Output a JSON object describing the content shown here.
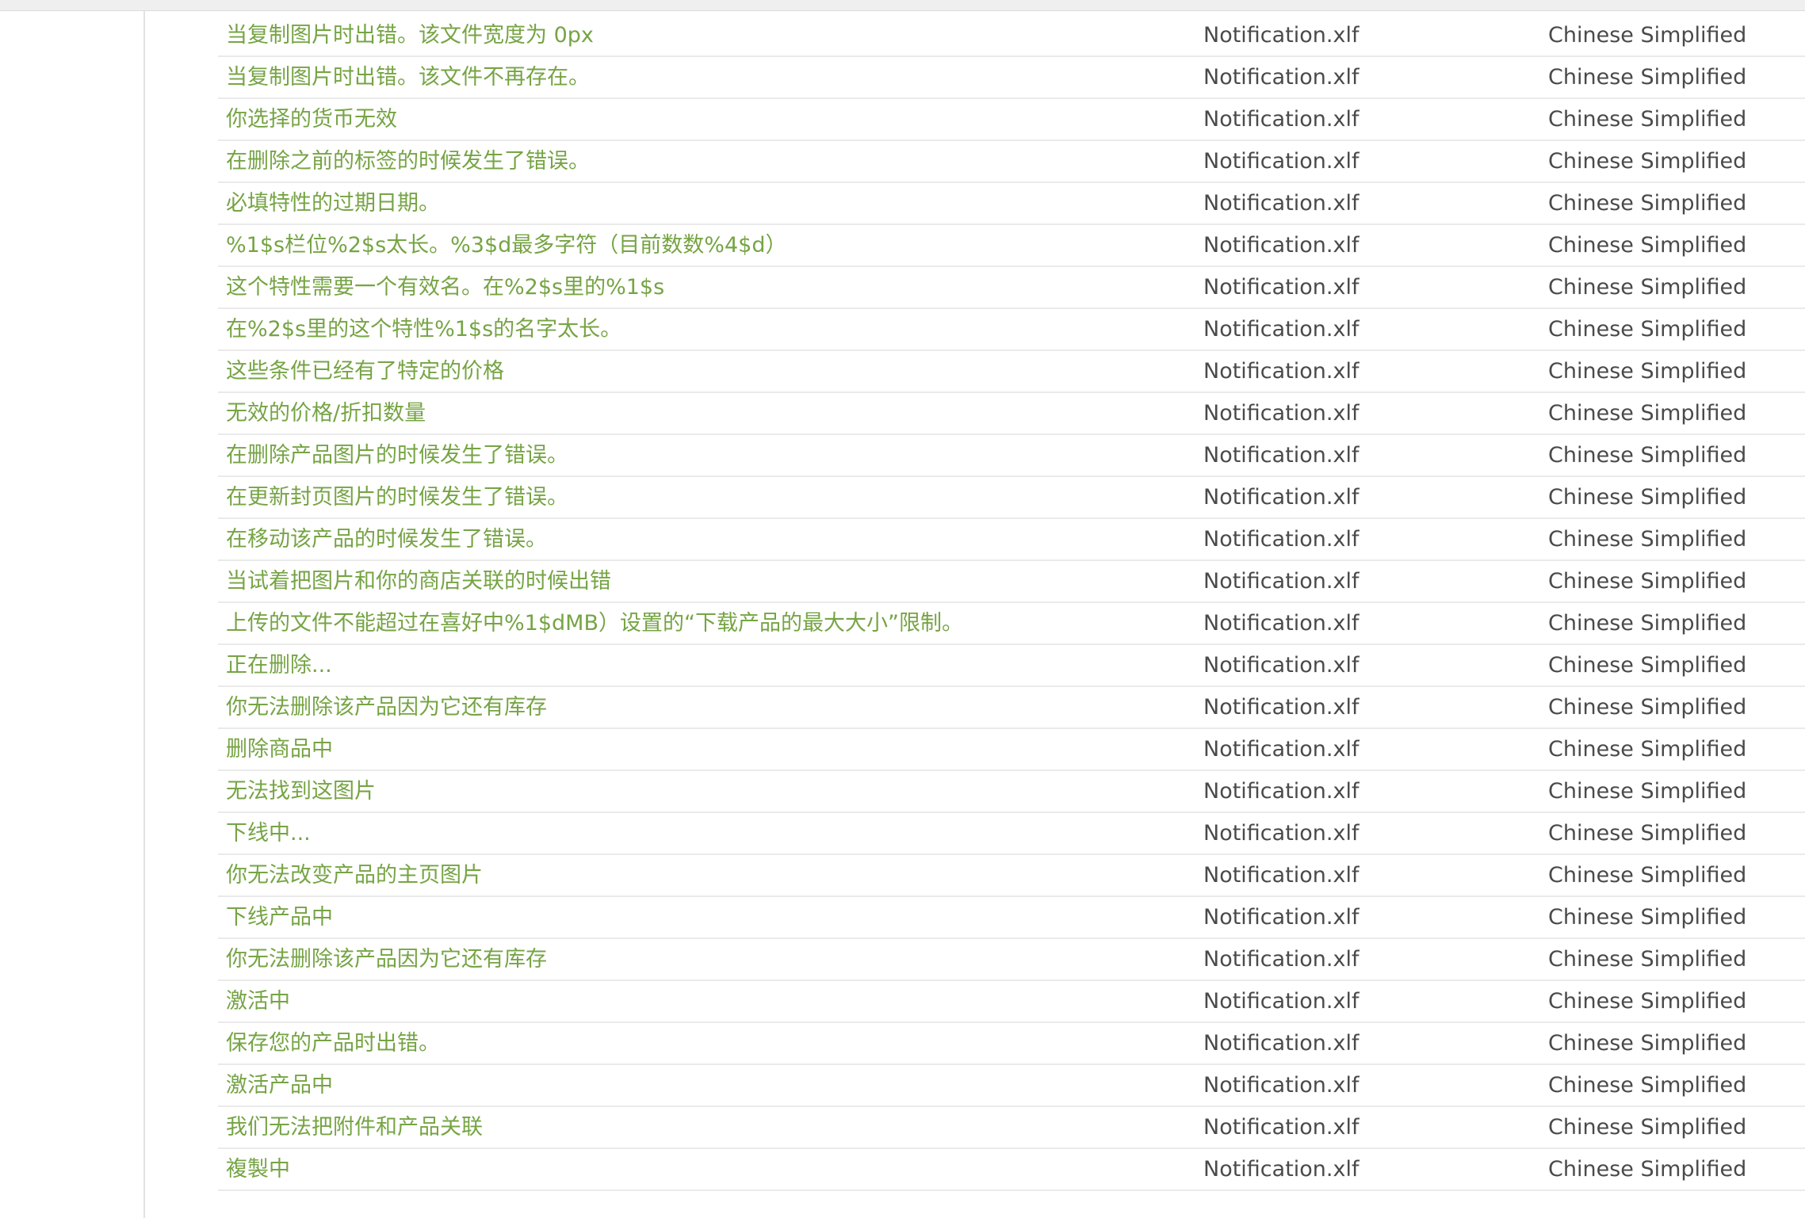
{
  "rows": [
    {
      "string": "当复制图片时出错。该文件宽度为 0px",
      "file": "Notification.xlf",
      "language": "Chinese Simplified"
    },
    {
      "string": "当复制图片时出错。该文件不再存在。",
      "file": "Notification.xlf",
      "language": "Chinese Simplified"
    },
    {
      "string": "你选择的货币无效",
      "file": "Notification.xlf",
      "language": "Chinese Simplified"
    },
    {
      "string": "在删除之前的标签的时候发生了错误。",
      "file": "Notification.xlf",
      "language": "Chinese Simplified"
    },
    {
      "string": "必填特性的过期日期。",
      "file": "Notification.xlf",
      "language": "Chinese Simplified"
    },
    {
      "string": "%1$s栏位%2$s太长。%3$d最多字符（目前数数%4$d）",
      "file": "Notification.xlf",
      "language": "Chinese Simplified"
    },
    {
      "string": "这个特性需要一个有效名。在%2$s里的%1$s",
      "file": "Notification.xlf",
      "language": "Chinese Simplified"
    },
    {
      "string": "在%2$s里的这个特性%1$s的名字太长。",
      "file": "Notification.xlf",
      "language": "Chinese Simplified"
    },
    {
      "string": "这些条件已经有了特定的价格",
      "file": "Notification.xlf",
      "language": "Chinese Simplified"
    },
    {
      "string": "无效的价格/折扣数量",
      "file": "Notification.xlf",
      "language": "Chinese Simplified"
    },
    {
      "string": "在删除产品图片的时候发生了错误。",
      "file": "Notification.xlf",
      "language": "Chinese Simplified"
    },
    {
      "string": "在更新封页图片的时候发生了错误。",
      "file": "Notification.xlf",
      "language": "Chinese Simplified"
    },
    {
      "string": "在移动该产品的时候发生了错误。",
      "file": "Notification.xlf",
      "language": "Chinese Simplified"
    },
    {
      "string": "当试着把图片和你的商店关联的时候出错",
      "file": "Notification.xlf",
      "language": "Chinese Simplified"
    },
    {
      "string": "上传的文件不能超过在喜好中%1$dMB）设置的“下载产品的最大大小”限制。",
      "file": "Notification.xlf",
      "language": "Chinese Simplified"
    },
    {
      "string": "正在删除...",
      "file": "Notification.xlf",
      "language": "Chinese Simplified"
    },
    {
      "string": "你无法删除该产品因为它还有库存",
      "file": "Notification.xlf",
      "language": "Chinese Simplified"
    },
    {
      "string": "删除商品中",
      "file": "Notification.xlf",
      "language": "Chinese Simplified"
    },
    {
      "string": "无法找到这图片",
      "file": "Notification.xlf",
      "language": "Chinese Simplified"
    },
    {
      "string": "下线中...",
      "file": "Notification.xlf",
      "language": "Chinese Simplified"
    },
    {
      "string": "你无法改变产品的主页图片",
      "file": "Notification.xlf",
      "language": "Chinese Simplified"
    },
    {
      "string": "下线产品中",
      "file": "Notification.xlf",
      "language": "Chinese Simplified"
    },
    {
      "string": "你无法删除该产品因为它还有库存",
      "file": "Notification.xlf",
      "language": "Chinese Simplified"
    },
    {
      "string": "激活中",
      "file": "Notification.xlf",
      "language": "Chinese Simplified"
    },
    {
      "string": "保存您的产品时出错。",
      "file": "Notification.xlf",
      "language": "Chinese Simplified"
    },
    {
      "string": "激活产品中",
      "file": "Notification.xlf",
      "language": "Chinese Simplified"
    },
    {
      "string": "我们无法把附件和产品关联",
      "file": "Notification.xlf",
      "language": "Chinese Simplified"
    },
    {
      "string": "複製中",
      "file": "Notification.xlf",
      "language": "Chinese Simplified"
    }
  ]
}
